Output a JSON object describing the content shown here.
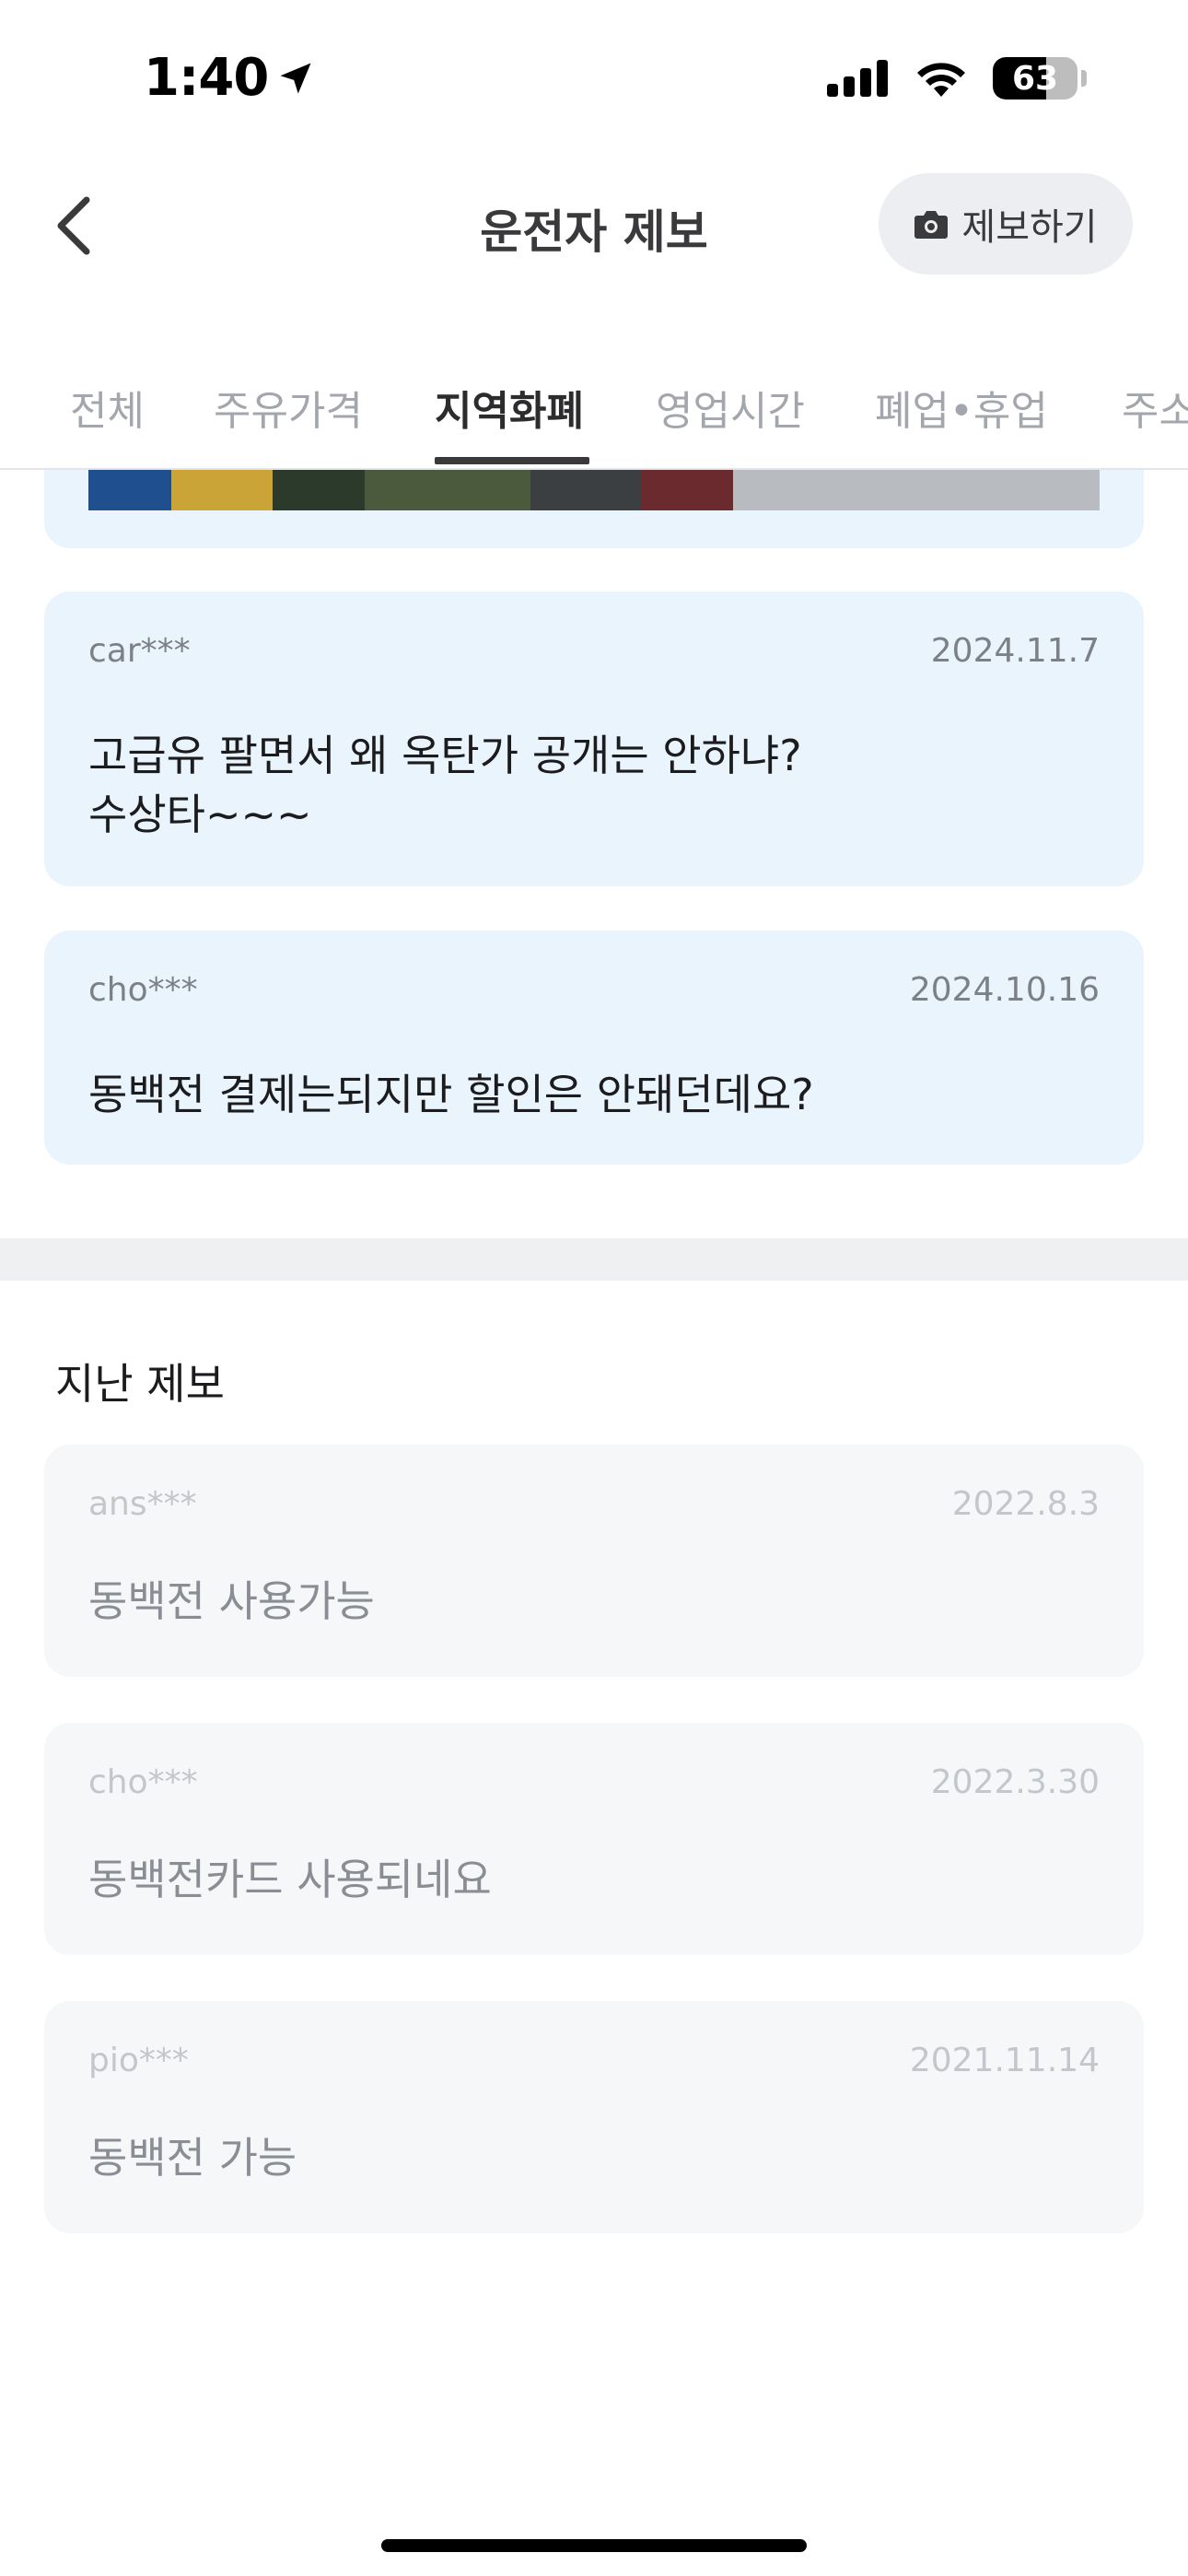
{
  "status_bar": {
    "time": "1:40",
    "battery": "63"
  },
  "header": {
    "title": "운전자 제보",
    "report_button_label": "제보하기"
  },
  "tabs": [
    {
      "label": "전체"
    },
    {
      "label": "주유가격"
    },
    {
      "label": "지역화폐",
      "active": true
    },
    {
      "label": "영업시간"
    },
    {
      "label": "폐업•휴업"
    },
    {
      "label": "주소"
    }
  ],
  "recent_reports": [
    {
      "user": "car***",
      "date": "2024.11.7",
      "text": "고급유 팔면서 왜 옥탄가 공개는 안하냐?\n수상타~~~"
    },
    {
      "user": "cho***",
      "date": "2024.10.16",
      "text": "동백전 결제는되지만 할인은 안돼던데요?"
    }
  ],
  "past_section": {
    "title": "지난 제보",
    "items": [
      {
        "user": "ans***",
        "date": "2022.8.3",
        "text": "동백전 사용가능"
      },
      {
        "user": "cho***",
        "date": "2022.3.30",
        "text": "동백전카드 사용되네요"
      },
      {
        "user": "pio***",
        "date": "2021.11.14",
        "text": "동백전 가능"
      }
    ]
  },
  "colors": {
    "recent_card_bg": "#e9f4fd",
    "past_card_bg": "#f6f7f9",
    "section_divider": "#eef0f2"
  }
}
